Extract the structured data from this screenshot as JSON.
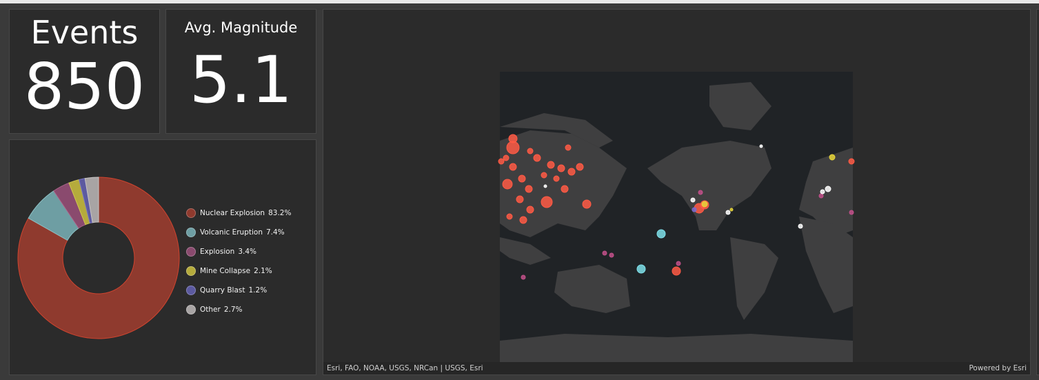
{
  "events": {
    "title": "Events",
    "value": "850"
  },
  "avg_magnitude": {
    "title": "Avg. Magnitude",
    "value": "5.1"
  },
  "chart_data": {
    "type": "pie",
    "donut": true,
    "categories": [
      "Nuclear Explosion",
      "Volcanic Eruption",
      "Explosion",
      "Mine Collapse",
      "Quarry Blast",
      "Other"
    ],
    "values": [
      83.2,
      7.4,
      3.4,
      2.1,
      1.2,
      2.7
    ],
    "labels": [
      "83.2%",
      "7.4%",
      "3.4%",
      "2.1%",
      "1.2%",
      "2.7%"
    ],
    "colors": [
      "#8f3a2e",
      "#6e9ea3",
      "#8a4a6e",
      "#b5ab3c",
      "#5c5aa0",
      "#a8a4a4"
    ],
    "legend_position": "right"
  },
  "map": {
    "attribution": "Esri, FAO, NOAA, USGS, NRCan | USGS, Esri",
    "powered_by": "Powered by Esri",
    "colors": {
      "nuclear": "#ff5a45",
      "volcanic": "#7fe0ea",
      "explosion": "#c2508a",
      "mine": "#e8d63a",
      "quarry": "#7a6ad0",
      "other": "#ffffff"
    }
  }
}
